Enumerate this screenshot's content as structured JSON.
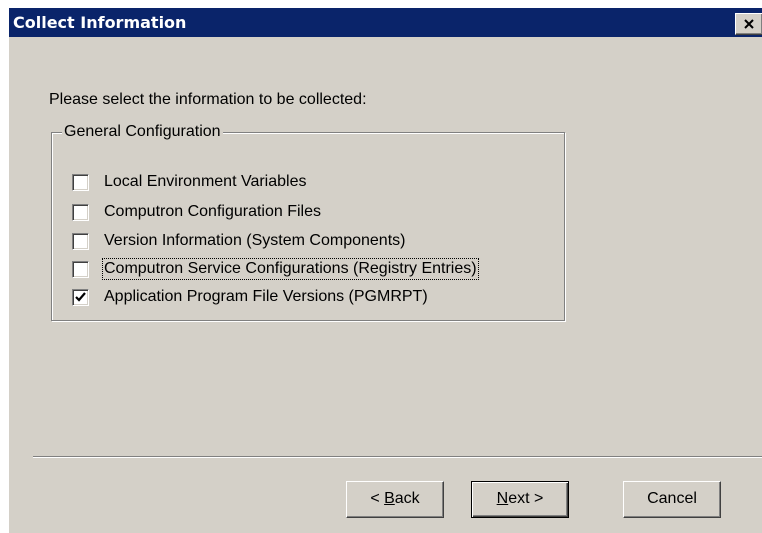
{
  "window": {
    "title": "Collect Information",
    "close_symbol": "close-icon"
  },
  "main": {
    "prompt": "Please select the information to be collected:",
    "group": {
      "label": "General Configuration",
      "items": [
        {
          "label": "Local Environment Variables",
          "checked": false
        },
        {
          "label": "Computron Configuration Files",
          "checked": false
        },
        {
          "label": "Version Information (System Components)",
          "checked": false
        },
        {
          "label": "Computron Service Configurations (Registry Entries)",
          "checked": false,
          "focused": true
        },
        {
          "label": "Application Program File Versions (PGMRPT)",
          "checked": true
        }
      ]
    }
  },
  "buttons": {
    "back": {
      "prefix": "< ",
      "mnemonic": "B",
      "rest": "ack"
    },
    "next": {
      "mnemonic": "N",
      "rest": "ext >"
    },
    "cancel": "Cancel"
  },
  "colors": {
    "titlebar": "#0a246a",
    "dialog_face": "#d4d0c8",
    "title_text": "#ffffff"
  }
}
